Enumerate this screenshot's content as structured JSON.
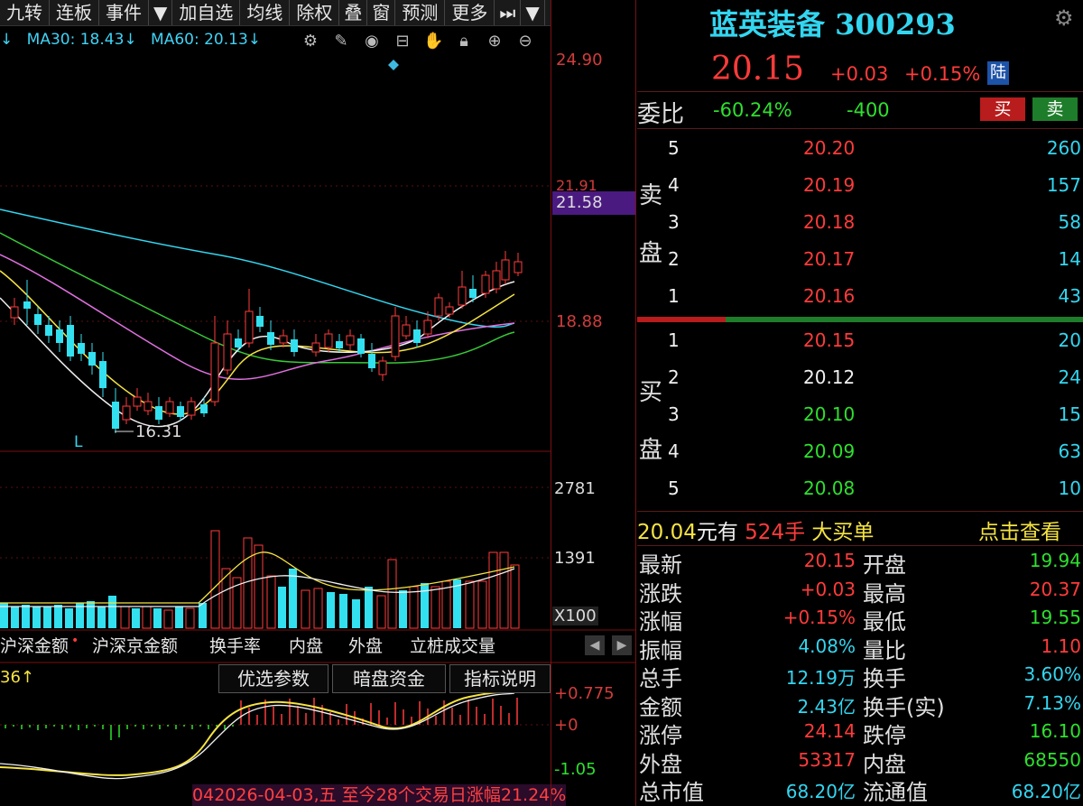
{
  "toolbar": {
    "items": [
      "九转",
      "连板",
      "事件",
      "▼",
      "加自选",
      "均线",
      "除权",
      "叠",
      "窗",
      "预测",
      "更多",
      "⏭",
      "▼"
    ]
  },
  "ma_legend": {
    "items": [
      "↓",
      "MA30: 18.43↓",
      "MA60: 20.13↓"
    ]
  },
  "tool_icons": [
    "gear-icon",
    "pen-icon",
    "eye-icon",
    "bag-icon",
    "hand-icon",
    "lock-icon",
    "zoom-in-icon",
    "zoom-out-icon"
  ],
  "price_axis": {
    "top": "24.90",
    "mid1": "21.91",
    "highlight": "21.58",
    "mid2": "18.88",
    "low_label": "16.31",
    "low_mark": "L"
  },
  "volume_axis": {
    "top": "2781",
    "mid": "1391",
    "unit": "X100"
  },
  "indicator_axis": {
    "top": "+0.775",
    "mid": "+0",
    "bottom": "-1.05",
    "left_label": "36↑"
  },
  "tabs_row1": [
    "沪深金额",
    "沪深京金额",
    "换手率",
    "内盘",
    "外盘",
    "立桩成交量"
  ],
  "tabs_row2": [
    "优选参数",
    "暗盘资金",
    "指标说明"
  ],
  "status": {
    "prefix": "04",
    "text": "2026-04-03,五 至今28个交易日涨幅21.24%"
  },
  "quote": {
    "name": "蓝英装备",
    "code": "300293",
    "price": "20.15",
    "change": "+0.03",
    "change_pct": "+0.15%",
    "market": "陆",
    "weibi_label": "委比",
    "weibi_pct": "-60.24%",
    "weibi_diff": "-400",
    "buy_btn": "买",
    "sell_btn": "卖",
    "sell_label": [
      "卖",
      "盘"
    ],
    "buy_label": [
      "买",
      "盘"
    ],
    "asks": [
      {
        "lvl": "5",
        "price": "20.20",
        "vol": "260"
      },
      {
        "lvl": "4",
        "price": "20.19",
        "vol": "157"
      },
      {
        "lvl": "3",
        "price": "20.18",
        "vol": "58"
      },
      {
        "lvl": "2",
        "price": "20.17",
        "vol": "14"
      },
      {
        "lvl": "1",
        "price": "20.16",
        "vol": "43"
      }
    ],
    "bids": [
      {
        "lvl": "1",
        "price": "20.15",
        "vol": "20"
      },
      {
        "lvl": "2",
        "price": "20.12",
        "vol": "24"
      },
      {
        "lvl": "3",
        "price": "20.10",
        "vol": "15"
      },
      {
        "lvl": "4",
        "price": "20.09",
        "vol": "63"
      },
      {
        "lvl": "5",
        "price": "20.08",
        "vol": "10"
      }
    ],
    "big_order": {
      "price": "20.04",
      "t1": "元有",
      "qty": "524手",
      "t2": "大买单",
      "link": "点击查看"
    },
    "stats_left": [
      [
        "最新",
        "20.15"
      ],
      [
        "涨跌",
        "+0.03"
      ],
      [
        "涨幅",
        "+0.15%"
      ],
      [
        "振幅",
        "4.08%"
      ],
      [
        "总手",
        "12.19万"
      ],
      [
        "金额",
        "2.43亿"
      ],
      [
        "涨停",
        "24.14"
      ],
      [
        "外盘",
        "53317"
      ],
      [
        "总市值",
        "68.20亿"
      ]
    ],
    "stats_right": [
      [
        "开盘",
        "19.94"
      ],
      [
        "最高",
        "20.37"
      ],
      [
        "最低",
        "19.55"
      ],
      [
        "量比",
        "1.10"
      ],
      [
        "换手",
        "3.60%"
      ],
      [
        "换手(实)",
        "7.13%"
      ],
      [
        "跌停",
        "16.10"
      ],
      [
        "内盘",
        "68550"
      ],
      [
        "流通值",
        "68.20亿"
      ]
    ]
  },
  "colors": {
    "up": "#ff3b3b",
    "down": "#2ee02e",
    "cyan": "#33d6f0",
    "yellow": "#f5e342"
  }
}
